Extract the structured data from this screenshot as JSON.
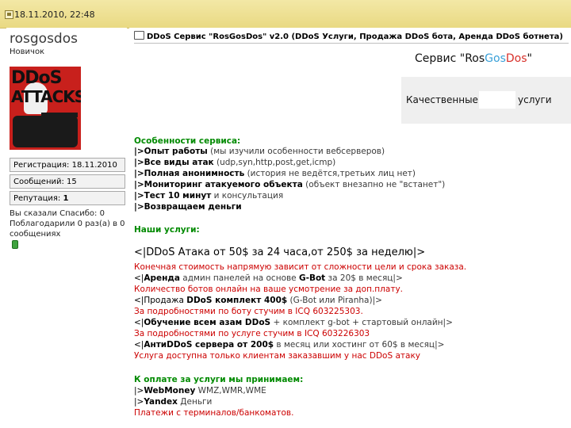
{
  "header": {
    "post_date": "18.11.2010, 22:48"
  },
  "user": {
    "username": "rosgosdos",
    "title": "Новичок",
    "avatar_text_1": "DDoS",
    "avatar_text_2": "ATTACKS",
    "registration": "Регистрация: 18.11.2010",
    "posts": "Сообщений: 15",
    "reputation_label": "Репутация:",
    "reputation_value": "1",
    "thanks_1": "Вы сказали Спасибо: 0",
    "thanks_2": "Поблагодарили 0 раз(а) в 0",
    "thanks_3": "сообщениях"
  },
  "post": {
    "title": "DDoS Сервис \"RosGosDos\" v2.0 (DDoS Услуги, Продажа DDoS бота, Аренда DDoS ботнета)",
    "banner_pre": "Сервис \"Ros",
    "banner_gos": "Gos",
    "banner_dos": "Dos",
    "banner_post": "\"",
    "banner2_a": "Качественные",
    "banner2_b": "услуги",
    "features_title": "Особенности сервиса:",
    "f1_b": "|>Опыт работы",
    "f1_n": " (мы изучили особенности вебсерверов)",
    "f2_b": "|>Все виды атак",
    "f2_n": " (udp,syn,http,post,get,icmp)",
    "f3_b": "|>Полная анонимность",
    "f3_n": " (история не ведётся,третьих лиц нет)",
    "f4_b": "|>Мониторинг атакуемого объекта",
    "f4_n": " (объект внезапно не \"встанет\")",
    "f5_b": "|>Тест 10 минут",
    "f5_n": " и консультация",
    "f6_b": "|>Возвращаем деньги",
    "services_title": "Наши услуги:",
    "s1": "<|DDoS Атака от 50$ за 24 часа,от 250$ за неделю|>",
    "s2": "Конечная стоимость напрямую зависит от сложности цели и срока заказа.",
    "s3_a": "<|",
    "s3_b": "Аренда",
    "s3_c": " админ панелей на основе ",
    "s3_d": "G-Bot",
    "s3_e": " за 20$ в месяц|>",
    "s4": "Количество ботов онлайн на ваше усмотрение за доп.плату.",
    "s5_a": "<|Продажа ",
    "s5_b": "DDoS комплект 400$",
    "s5_c": " (G-Bot или Piranha)|>",
    "s6": "За подробностями по боту стучим в ICQ 603225303.",
    "s7_a": "<|",
    "s7_b": "Обучение всем азам DDoS",
    "s7_c": " + комплект g-bot + стартовый онлайн|>",
    "s8": "За подробностями по услуге стучим в ICQ 603226303",
    "s9_a": "<|",
    "s9_b": "АнтиDDoS сервера от 200$",
    "s9_c": " в месяц или хостинг от 60$ в месяц|>",
    "s10": "Услуга доступна только клиентам заказавшим у нас DDoS атаку",
    "pay_title": "К оплате за услуги мы принимаем:",
    "p1_a": "|>",
    "p1_b": "WebMoney",
    "p1_c": " WMZ,WMR,WME",
    "p2_a": "|>",
    "p2_b": "Yandex",
    "p2_c": " Деньги",
    "p3": "Платежи с терминалов/банкоматов."
  }
}
